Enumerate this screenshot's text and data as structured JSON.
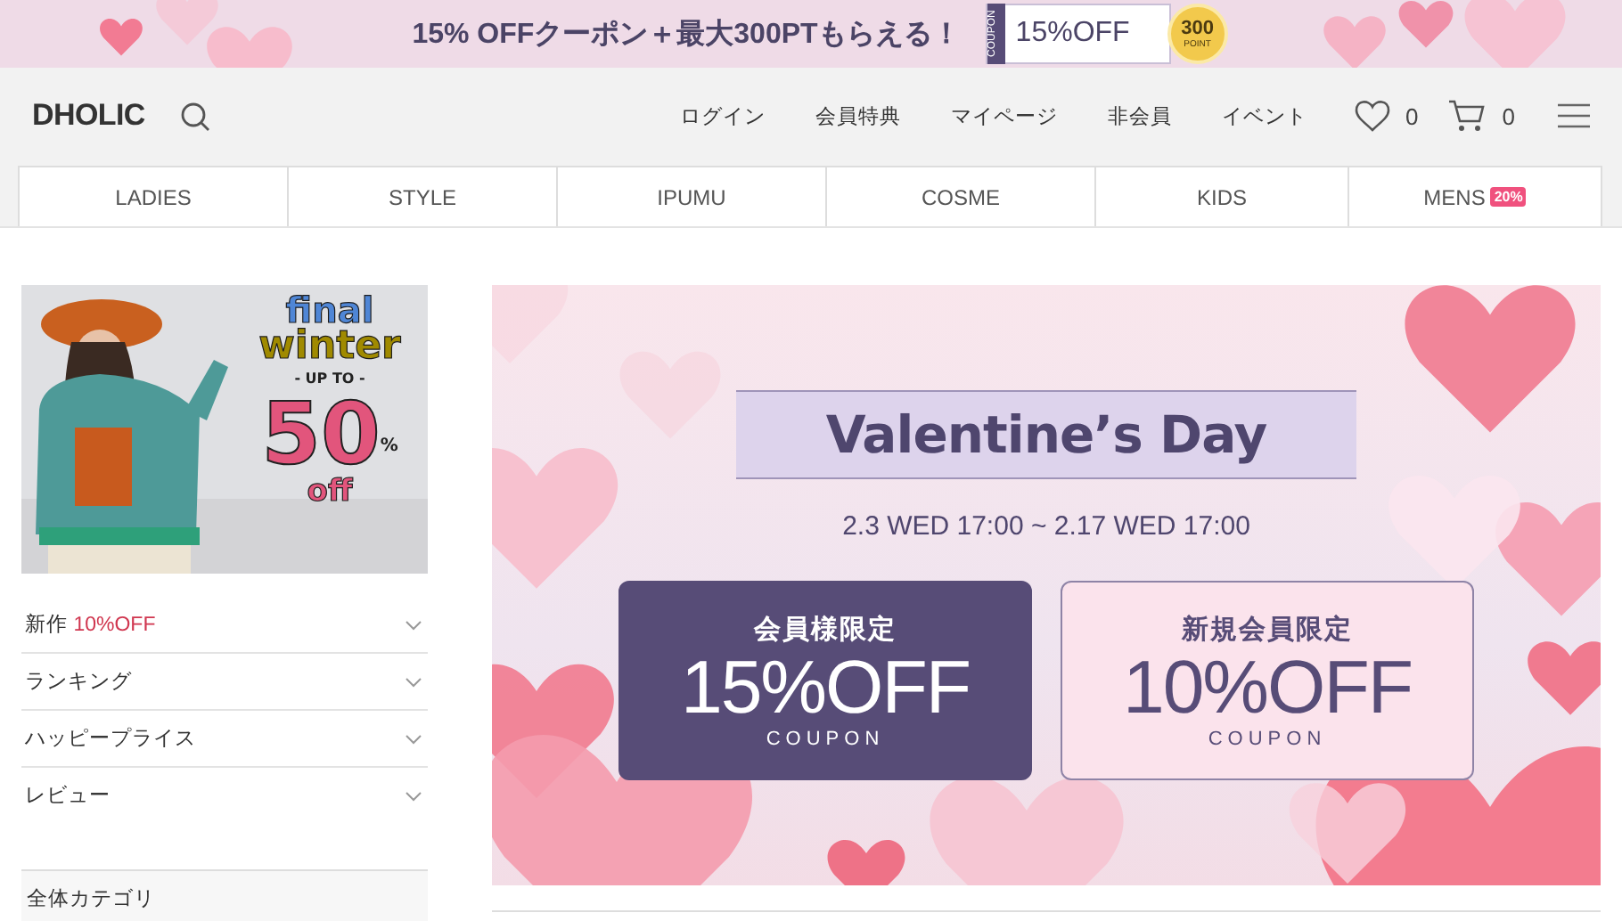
{
  "promo_bar": {
    "text": "15% OFFクーポン＋最大300PTもらえる！",
    "coupon_label": "COUPON",
    "coupon_value": "15%OFF",
    "point_value": "300",
    "point_label": "POINT"
  },
  "header": {
    "logo": "DHOLIC",
    "links": [
      "ログイン",
      "会員特典",
      "マイページ",
      "非会員",
      "イベント"
    ],
    "wishlist_count": "0",
    "cart_count": "0"
  },
  "categories": [
    {
      "label": "LADIES"
    },
    {
      "label": "STYLE"
    },
    {
      "label": "IPUMU"
    },
    {
      "label": "COSME"
    },
    {
      "label": "KIDS"
    },
    {
      "label": "MENS",
      "badge": "20%"
    }
  ],
  "side_banner": {
    "kind": "picture",
    "line_1": "final",
    "line_2": "winter",
    "subtitle": "- UP TO -",
    "discount": "50",
    "percent": "%",
    "off": "off"
  },
  "side_menu": [
    {
      "label": "新作",
      "highlight": "10%OFF",
      "expanded": false
    },
    {
      "label": "ランキング",
      "expanded": false
    },
    {
      "label": "ハッピープライス",
      "expanded": false
    },
    {
      "label": "レビュー",
      "expanded": false
    }
  ],
  "category_header": "全体カテゴリ",
  "hero": {
    "title": "Valentine’s Day",
    "dates": "2.3 WED 17:00 ~ 2.17 WED 17:00",
    "coupons": [
      {
        "kind": "dark",
        "heading": "会員様限定",
        "value": "15%OFF",
        "label": "COUPON"
      },
      {
        "kind": "light",
        "heading": "新規会員限定",
        "value": "10%OFF",
        "label": "COUPON"
      }
    ]
  }
}
